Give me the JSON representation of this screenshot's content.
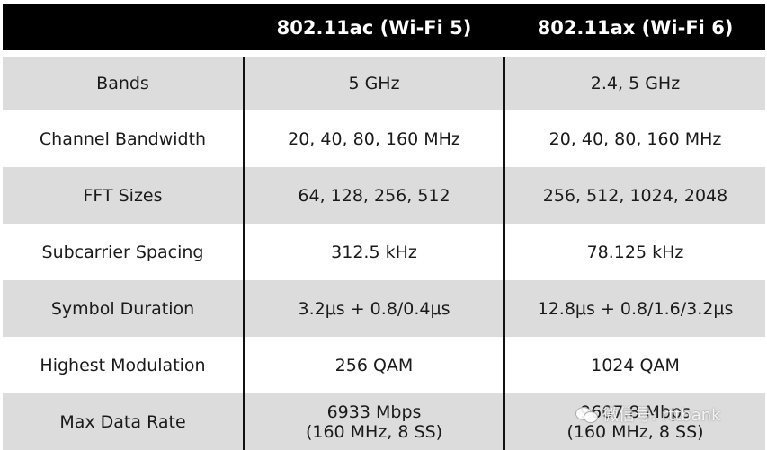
{
  "header": {
    "col0": "",
    "col1": "802.11ac (Wi-Fi 5)",
    "col2": "802.11ax (Wi-Fi 6)"
  },
  "rows": [
    {
      "label": "Bands",
      "ac": "5 GHz",
      "ax": "2.4, 5 GHz"
    },
    {
      "label": "Channel Bandwidth",
      "ac": "20, 40, 80, 160 MHz",
      "ax": "20, 40, 80, 160 MHz"
    },
    {
      "label": "FFT Sizes",
      "ac": "64, 128, 256, 512",
      "ax": "256, 512, 1024, 2048"
    },
    {
      "label": "Subcarrier Spacing",
      "ac": "312.5 kHz",
      "ax": "78.125 kHz"
    },
    {
      "label": "Symbol Duration",
      "ac": "3.2μs + 0.8/0.4μs",
      "ax": "12.8μs + 0.8/1.6/3.2μs"
    },
    {
      "label": "Highest Modulation",
      "ac": "256 QAM",
      "ax": "1024 QAM"
    },
    {
      "label": "Max Data Rate",
      "ac": "6933 Mbps",
      "ac2": "(160 MHz, 8 SS)",
      "ax": "9607.8 Mbps",
      "ax2": "(160 MHz, 8 SS)"
    }
  ],
  "watermark": {
    "icon": "wechat-icon",
    "text": "微信号: rttbank"
  }
}
